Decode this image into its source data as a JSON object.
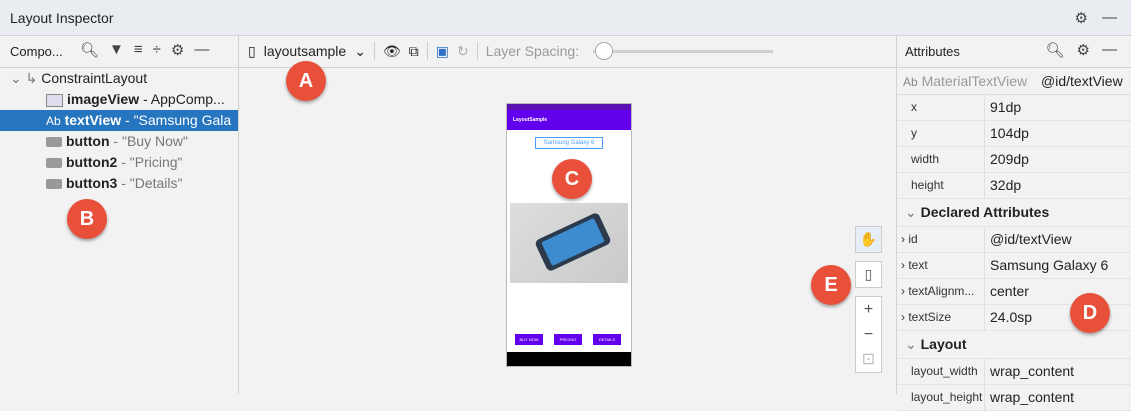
{
  "window": {
    "title": "Layout Inspector"
  },
  "components": {
    "header": "Compo...",
    "tree": [
      {
        "name": "ConstraintLayout",
        "detail": ""
      },
      {
        "name": "imageView",
        "detail": " - AppComp..."
      },
      {
        "name": "textView",
        "detail": " - \"Samsung Gala",
        "selected": true
      },
      {
        "name": "button",
        "detail": " - \"Buy Now\""
      },
      {
        "name": "button2",
        "detail": " - \"Pricing\""
      },
      {
        "name": "button3",
        "detail": " - \"Details\""
      }
    ]
  },
  "toolbar": {
    "device": "layoutsample",
    "layer_spacing": "Layer Spacing:"
  },
  "preview": {
    "appbar_title": "LayoutSample",
    "text_label": "Samsung Galaxy 6",
    "buttons": [
      "BUY NOW",
      "PRICING",
      "DETAILS"
    ]
  },
  "attributes": {
    "header": "Attributes",
    "selected_class": "MaterialTextView",
    "selected_id": "@id/textView",
    "basic": [
      {
        "key": "x",
        "value": "91dp"
      },
      {
        "key": "y",
        "value": "104dp"
      },
      {
        "key": "width",
        "value": "209dp"
      },
      {
        "key": "height",
        "value": "32dp"
      }
    ],
    "declared_title": "Declared Attributes",
    "declared": [
      {
        "key": "id",
        "value": "@id/textView"
      },
      {
        "key": "text",
        "value": "Samsung Galaxy 6"
      },
      {
        "key": "textAlignm...",
        "value": "center"
      },
      {
        "key": "textSize",
        "value": "24.0sp"
      }
    ],
    "layout_title": "Layout",
    "layout": [
      {
        "key": "layout_width",
        "value": "wrap_content"
      },
      {
        "key": "layout_height",
        "value": "wrap_content"
      }
    ]
  },
  "badges": {
    "a": "A",
    "b": "B",
    "c": "C",
    "d": "D",
    "e": "E"
  }
}
